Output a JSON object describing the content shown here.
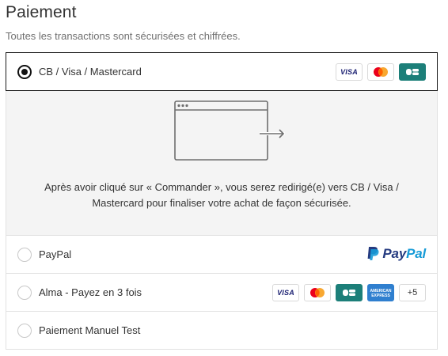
{
  "header": {
    "title": "Paiement",
    "subtitle": "Toutes les transactions sont sécurisées et chiffrées."
  },
  "methods": [
    {
      "label": "CB / Visa / Mastercard",
      "selected": true,
      "logos": [
        "visa-logo",
        "mastercard-logo",
        "cb-logo"
      ],
      "redirect_message": "Après avoir cliqué sur « Commander », vous serez redirigé(e) vers CB / Visa / Mastercard pour finaliser votre achat de façon sécurisée."
    },
    {
      "label": "PayPal",
      "selected": false,
      "logo": {
        "icon": "paypal-logo",
        "word_pay": "Pay",
        "word_pal": "Pal"
      }
    },
    {
      "label": "Alma - Payez en 3 fois",
      "selected": false,
      "logos": [
        "visa-logo",
        "mastercard-logo",
        "cb-logo",
        "amex-logo"
      ],
      "more_count": "+5"
    },
    {
      "label": "Paiement Manuel Test",
      "selected": false
    }
  ],
  "logos_text": {
    "visa": "VISA",
    "amex": "AMERICAN EXPRESS"
  },
  "colors": {
    "selected_border": "#1a1a1a",
    "panel_background": "#f4f4f4",
    "visa_blue": "#1a1f71",
    "mastercard_red": "#eb001b",
    "mastercard_orange": "#f79e1b",
    "cb_teal": "#1c7f79",
    "amex_blue": "#2f7fcf",
    "paypal_dark": "#253b80",
    "paypal_light": "#179bd7"
  }
}
